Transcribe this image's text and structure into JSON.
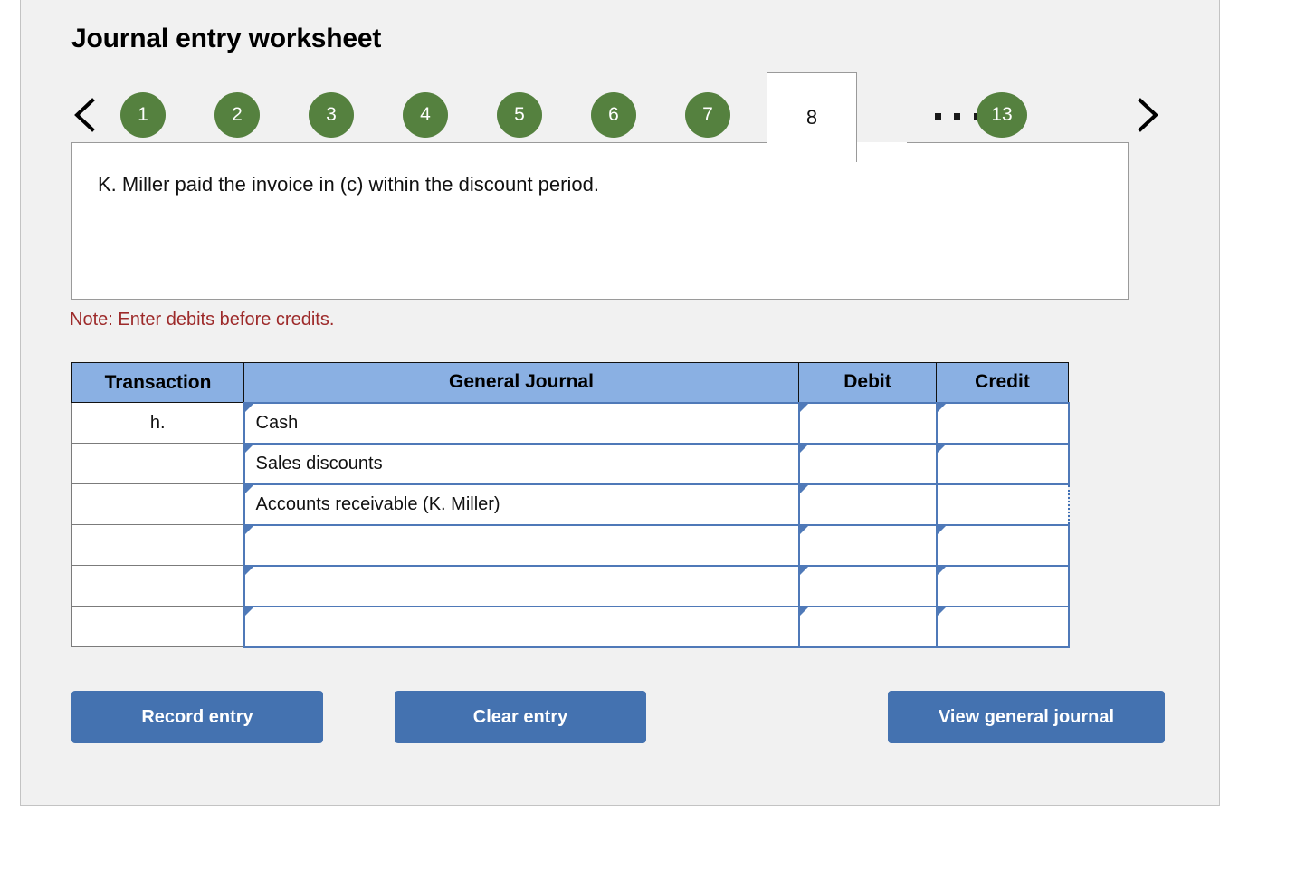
{
  "title": "Journal entry worksheet",
  "tabs": {
    "prev_icon": "chevron-left-icon",
    "next_icon": "chevron-right-icon",
    "items": [
      "1",
      "2",
      "3",
      "4",
      "5",
      "6",
      "7"
    ],
    "active": "8",
    "ellipsis": ".....",
    "last": "13"
  },
  "prompt": {
    "text": "K. Miller paid the invoice in (c) within the discount period."
  },
  "note": "Note: Enter debits before credits.",
  "table": {
    "headers": [
      "Transaction",
      "General Journal",
      "Debit",
      "Credit"
    ],
    "rows": [
      {
        "transaction": "h.",
        "general_journal": "Cash",
        "debit": "",
        "credit": ""
      },
      {
        "transaction": "",
        "general_journal": "Sales discounts",
        "debit": "",
        "credit": ""
      },
      {
        "transaction": "",
        "general_journal": "Accounts receivable (K. Miller)",
        "debit": "",
        "credit": ""
      },
      {
        "transaction": "",
        "general_journal": "",
        "debit": "",
        "credit": ""
      },
      {
        "transaction": "",
        "general_journal": "",
        "debit": "",
        "credit": ""
      },
      {
        "transaction": "",
        "general_journal": "",
        "debit": "",
        "credit": ""
      }
    ],
    "focused_cell": {
      "row": 2,
      "column": "credit"
    }
  },
  "buttons": {
    "record": "Record entry",
    "clear": "Clear entry",
    "view": "View general journal"
  },
  "colors": {
    "tab_pill": "#55813f",
    "table_header": "#8ab0e3",
    "field_border": "#4f79b8",
    "button": "#4472b0",
    "note_text": "#9d2a2a",
    "card_background": "#f1f1f1"
  }
}
